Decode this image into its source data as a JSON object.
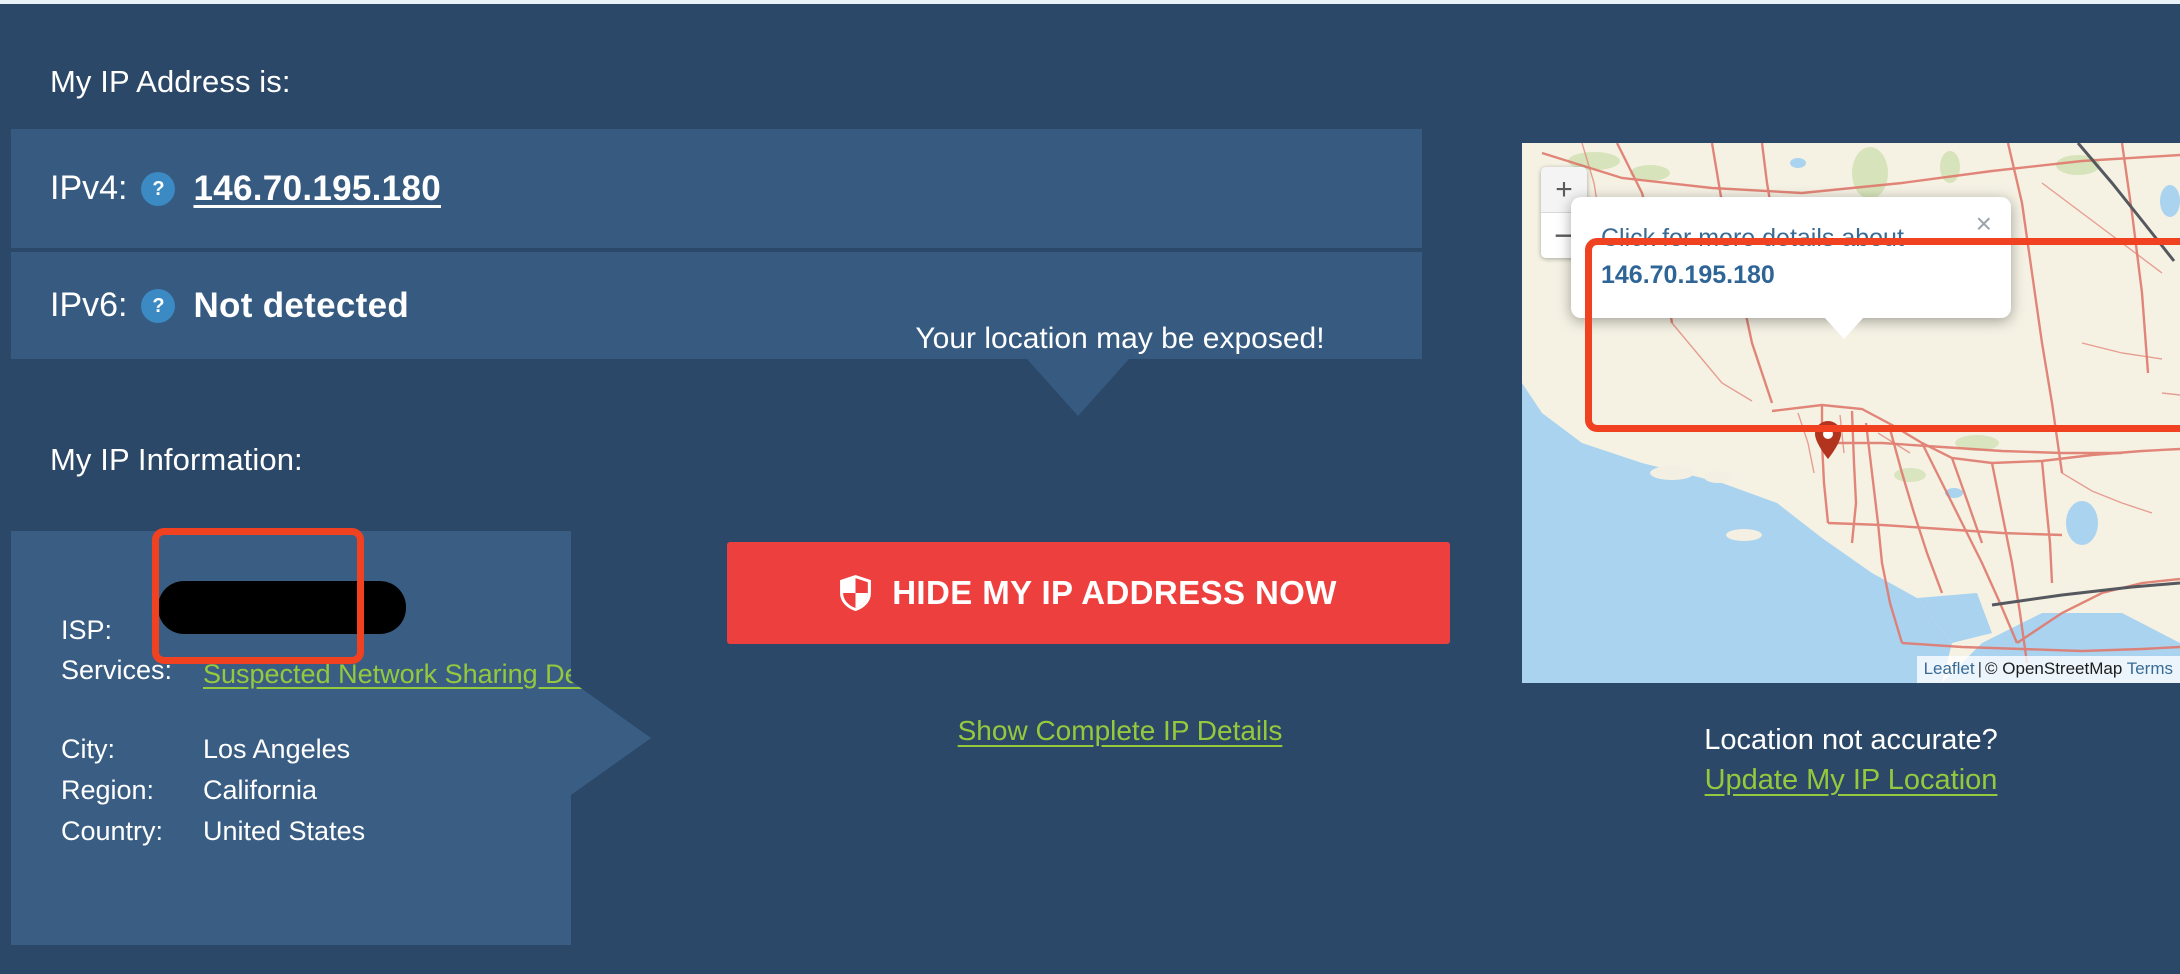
{
  "headings": {
    "my_ip_address": "My IP Address is:",
    "my_ip_information": "My IP Information:"
  },
  "ip_rows": {
    "ipv4_label": "IPv4:",
    "ipv4_value": "146.70.195.180",
    "ipv6_label": "IPv6:",
    "ipv6_value": "Not detected",
    "help_glyph": "?"
  },
  "info": {
    "isp_label": "ISP:",
    "isp_value": "",
    "services_label": "Services:",
    "services_value": "Suspected Network Sharing Device",
    "city_label": "City:",
    "city_value": "Los Angeles",
    "region_label": "Region:",
    "region_value": "California",
    "country_label": "Country:",
    "country_value": "United States"
  },
  "cta": {
    "exposed_text": "Your location may be exposed!",
    "hide_button_label": "HIDE MY IP ADDRESS NOW",
    "show_details_label": "Show Complete IP Details"
  },
  "map": {
    "zoom_in_label": "+",
    "zoom_out_label": "−",
    "popup_line1": "Click for more details about",
    "popup_line2": "146.70.195.180",
    "popup_close_label": "×",
    "attrib_leaflet": "Leaflet",
    "attrib_separator": "|",
    "attrib_osm": "© OpenStreetMap",
    "attrib_terms": "Terms"
  },
  "right_column": {
    "location_not_accurate": "Location not accurate?",
    "update_location_label": "Update My IP Location"
  },
  "colors": {
    "page_bg": "#2b4868",
    "panel_bg": "#365a80",
    "card_bg": "#3a5d83",
    "accent_red": "#ee3f3f",
    "highlight_red": "#f04120",
    "green_link": "#95c93d",
    "help_blue": "#3b8ac4",
    "map_link_blue": "#386b95",
    "popup_text_blue": "#2f6596"
  }
}
